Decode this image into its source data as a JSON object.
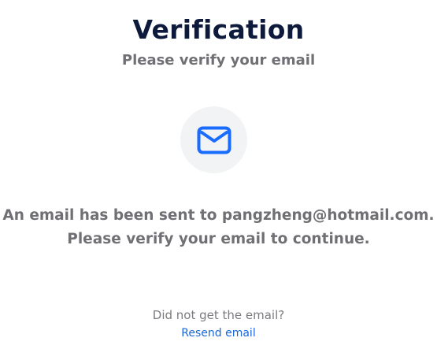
{
  "header": {
    "title": "Verification",
    "subtitle": "Please verify your email"
  },
  "icon": {
    "name": "mail-icon",
    "color": "#1a6bff",
    "background": "#f2f3f5"
  },
  "message": {
    "line1": "An email has been sent to pangzheng@hotmail.com.",
    "line2": "Please verify your email to continue."
  },
  "resend": {
    "question": "Did not get the email?",
    "link_label": "Resend email",
    "link_color": "#1a66d9"
  }
}
